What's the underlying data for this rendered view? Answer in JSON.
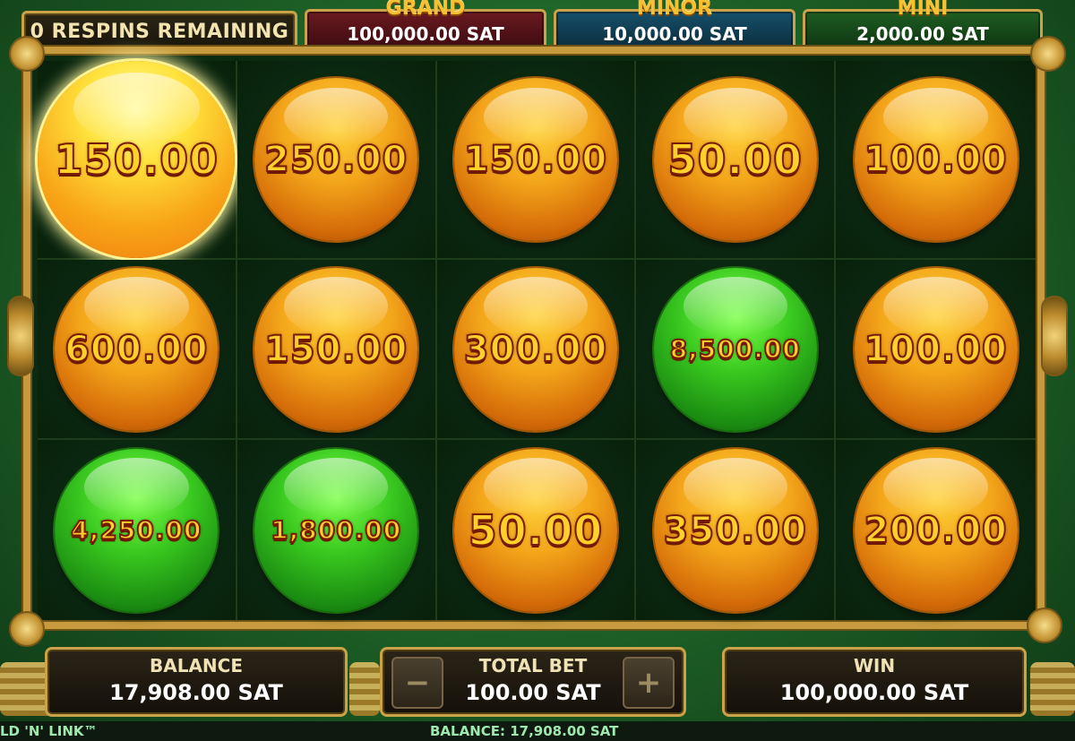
{
  "header": {
    "respins": "0 RESPINS REMAINING",
    "jackpots": [
      {
        "name": "GRAND",
        "value": "100,000.00 SAT",
        "color": "#6a1a20"
      },
      {
        "name": "MINOR",
        "value": "10,000.00 SAT",
        "color": "#16506a"
      },
      {
        "name": "MINI",
        "value": "2,000.00 SAT",
        "color": "#1f5e22"
      }
    ]
  },
  "grid": {
    "rows": [
      [
        {
          "value": "150.00",
          "orb": "highlight"
        },
        {
          "value": "250.00",
          "orb": "gold"
        },
        {
          "value": "150.00",
          "orb": "gold"
        },
        {
          "value": "50.00",
          "orb": "gold"
        },
        {
          "value": "100.00",
          "orb": "gold"
        }
      ],
      [
        {
          "value": "600.00",
          "orb": "gold"
        },
        {
          "value": "150.00",
          "orb": "gold"
        },
        {
          "value": "300.00",
          "orb": "gold"
        },
        {
          "value": "8,500.00",
          "orb": "green"
        },
        {
          "value": "100.00",
          "orb": "gold"
        }
      ],
      [
        {
          "value": "4,250.00",
          "orb": "green"
        },
        {
          "value": "1,800.00",
          "orb": "green"
        },
        {
          "value": "50.00",
          "orb": "gold"
        },
        {
          "value": "350.00",
          "orb": "gold"
        },
        {
          "value": "200.00",
          "orb": "gold"
        }
      ]
    ]
  },
  "panels": {
    "balance_label": "BALANCE",
    "balance_value": "17,908.00 SAT",
    "bet_label": "TOTAL BET",
    "bet_value": "100.00 SAT",
    "bet_minus": "−",
    "bet_plus": "+",
    "win_label": "WIN",
    "win_value": "100,000.00 SAT"
  },
  "footer": {
    "game_title": "LD 'N' LINK™",
    "balance": "BALANCE: 17,908.00 SAT"
  },
  "colors": {
    "gold_orb": "#f3a51a",
    "green_orb": "#39c81f",
    "frame_gold": "#c79a3e"
  }
}
